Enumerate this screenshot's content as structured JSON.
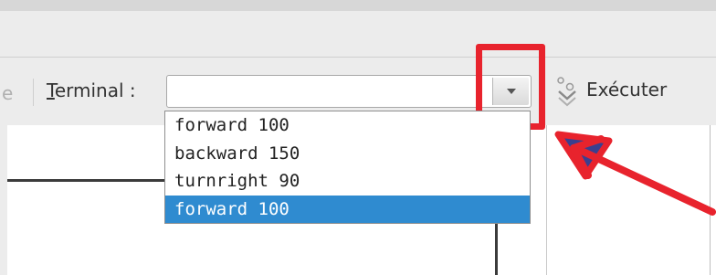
{
  "toolbar": {
    "prev_label_fragment": "e",
    "terminal_label_mnemonic": "T",
    "terminal_label_rest": "erminal :",
    "terminal_input": {
      "value": "",
      "placeholder": ""
    },
    "execute_label": "Exécuter"
  },
  "dropdown": {
    "items": [
      {
        "label": "forward 100",
        "selected": false
      },
      {
        "label": "backward 150",
        "selected": false
      },
      {
        "label": "turnright 90",
        "selected": false
      },
      {
        "label": "forward 100",
        "selected": true
      }
    ]
  },
  "colors": {
    "highlight": "#e8232d",
    "selection": "#2f8bd0",
    "turtle": "#3b3f8f"
  },
  "icons": {
    "dropdown_arrow": "chevron-down-icon",
    "execute": "execute-icon"
  }
}
